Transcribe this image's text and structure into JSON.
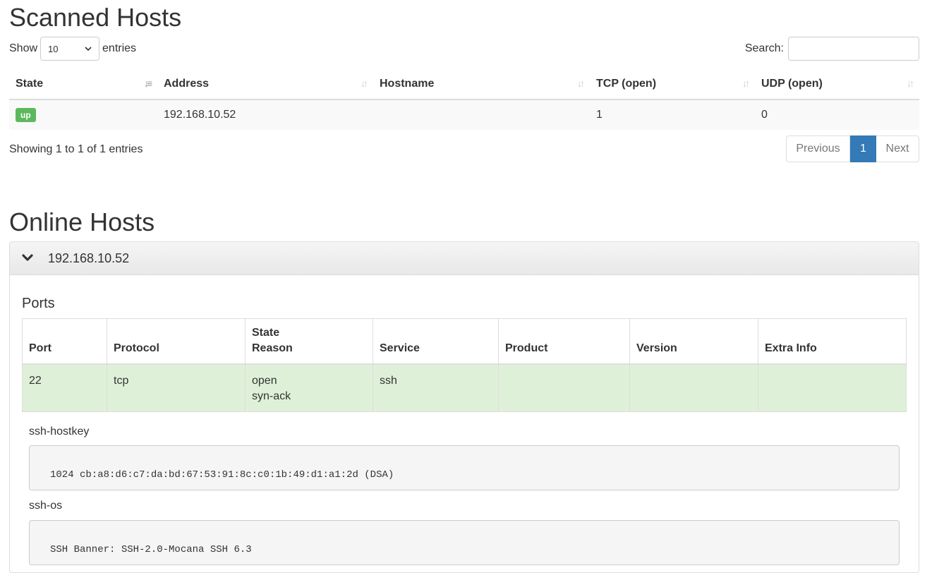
{
  "scanned": {
    "title": "Scanned Hosts",
    "show_label": "Show",
    "entries_value": "10",
    "entries_label": "entries",
    "search_label": "Search:",
    "search_value": "",
    "columns": [
      "State",
      "Address",
      "Hostname",
      "TCP (open)",
      "UDP (open)"
    ],
    "rows": [
      {
        "state": "up",
        "address": "192.168.10.52",
        "hostname": "",
        "tcp": "1",
        "udp": "0"
      }
    ],
    "info": "Showing 1 to 1 of 1 entries",
    "pager": {
      "previous": "Previous",
      "page": "1",
      "next": "Next"
    },
    "colors": {
      "up_badge": "#5cb85c",
      "active_page": "#337ab7"
    }
  },
  "online": {
    "title": "Online Hosts",
    "host": "192.168.10.52",
    "ports_title": "Ports",
    "columns": [
      "Port",
      "Protocol",
      "State",
      "Reason",
      "Service",
      "Product",
      "Version",
      "Extra Info"
    ],
    "rows": [
      {
        "port": "22",
        "protocol": "tcp",
        "state": "open",
        "reason": "syn-ack",
        "service": "ssh",
        "product": "",
        "version": "",
        "extra": ""
      }
    ],
    "scripts": [
      {
        "name": "ssh-hostkey",
        "output": "1024 cb:a8:d6:c7:da:bd:67:53:91:8c:c0:1b:49:d1:a1:2d (DSA)"
      },
      {
        "name": "ssh-os",
        "output": "SSH Banner: SSH-2.0-Mocana SSH 6.3"
      }
    ],
    "colors": {
      "open_row": "#dff0d8"
    }
  }
}
